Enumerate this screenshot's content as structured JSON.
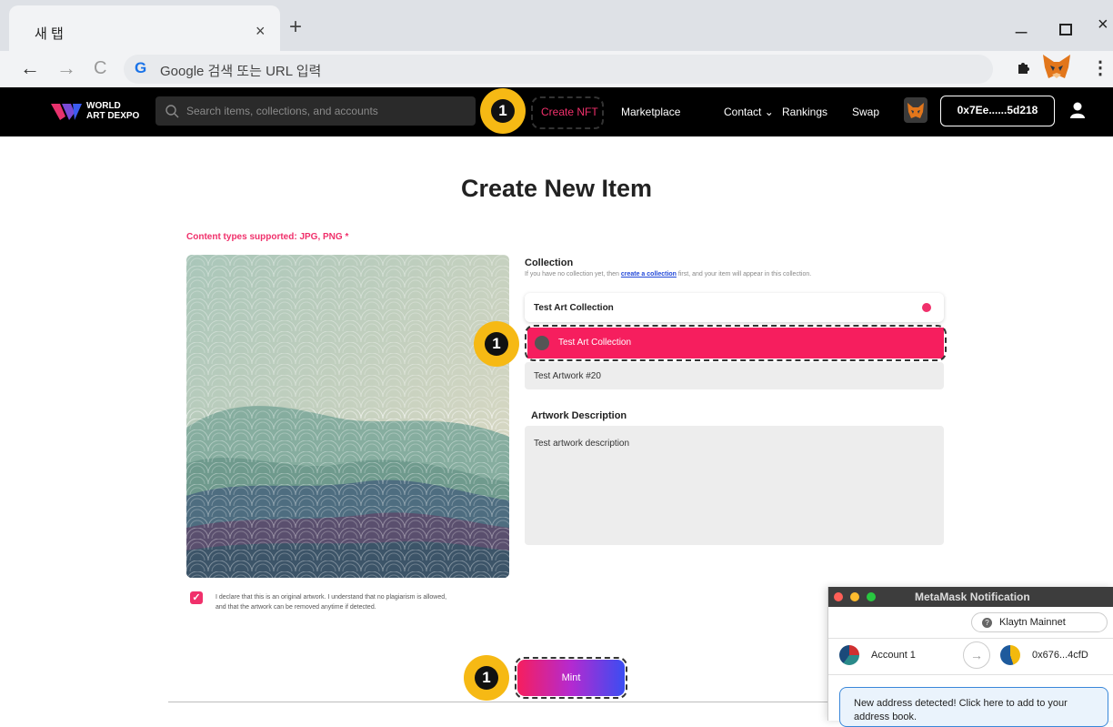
{
  "browser": {
    "tab_title": "새 탭",
    "tab_close": "×",
    "new_tab": "+",
    "back": "←",
    "forward": "→",
    "reload": "C",
    "omnibox_g": "G",
    "omnibox_placeholder": "Google 검색 또는 URL 입력",
    "window_min": "_",
    "window_close": "×",
    "menu": "⋮"
  },
  "header": {
    "logo_line1": "WORLD",
    "logo_line2": "ART DEXPO",
    "search_placeholder": "Search items, collections, and accounts",
    "nav": {
      "create": "Create NFT",
      "marketplace": "Marketplace",
      "contact": "Contact ⌄",
      "rankings": "Rankings",
      "swap": "Swap"
    },
    "wallet_address": "0x7Ee......5d218"
  },
  "badges": {
    "step_label": "1"
  },
  "form": {
    "title": "Create New Item",
    "content_types": "Content types supported: JPG, PNG *",
    "collection_label": "Collection",
    "collection_help_before": "If you have no collection yet, then ",
    "collection_help_link": "create a collection",
    "collection_help_after": " first, and your item will appear in this collection.",
    "collection_selected": "Test Art Collection",
    "collection_option": "Test Art Collection",
    "artwork_name": "Test Artwork #20",
    "description_label": "Artwork Description",
    "description_value": "Test artwork description",
    "checkbox_checked": "✓",
    "declaration_line1": "I declare that this is an original artwork. I understand that no plagiarism is allowed,",
    "declaration_line2": "and that the artwork can be removed anytime if detected.",
    "mint_label": "Mint"
  },
  "metamask": {
    "title": "MetaMask Notification",
    "network_q": "?",
    "network": "Klaytn Mainnet",
    "from_account": "Account 1",
    "arrow": "→",
    "to_address": "0x676...4cfD",
    "notice_line1": "New address detected! Click here to add to your",
    "notice_line2": "address book."
  },
  "colors": {
    "accent_pink": "#f0306b",
    "option_pink": "#f61e5e",
    "badge_yellow": "#f6b914",
    "link_blue": "#2148d8"
  }
}
